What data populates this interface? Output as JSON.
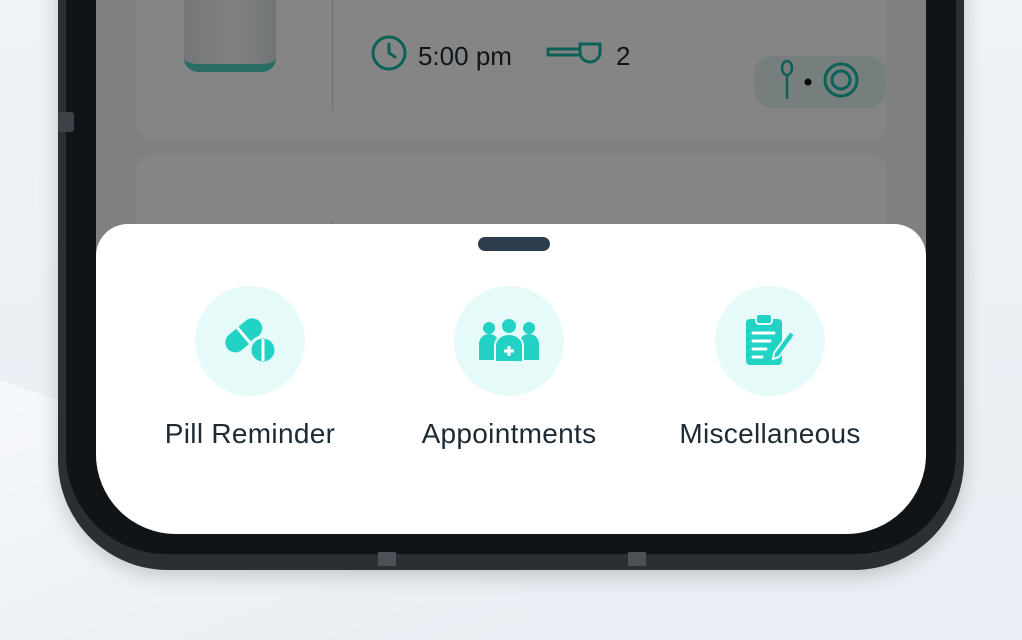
{
  "background_card": {
    "time": "5:00 pm",
    "dose_count": "2"
  },
  "sheet": {
    "options": [
      {
        "label": "Pill Reminder",
        "icon": "pill-icon"
      },
      {
        "label": "Appointments",
        "icon": "doctors-group-icon"
      },
      {
        "label": "Miscellaneous",
        "icon": "clipboard-edit-icon"
      }
    ]
  },
  "colors": {
    "accent": "#22d3c5",
    "icon_bg": "#e6fbf9",
    "handle": "#2c3e4c",
    "text": "#1e2a33"
  }
}
